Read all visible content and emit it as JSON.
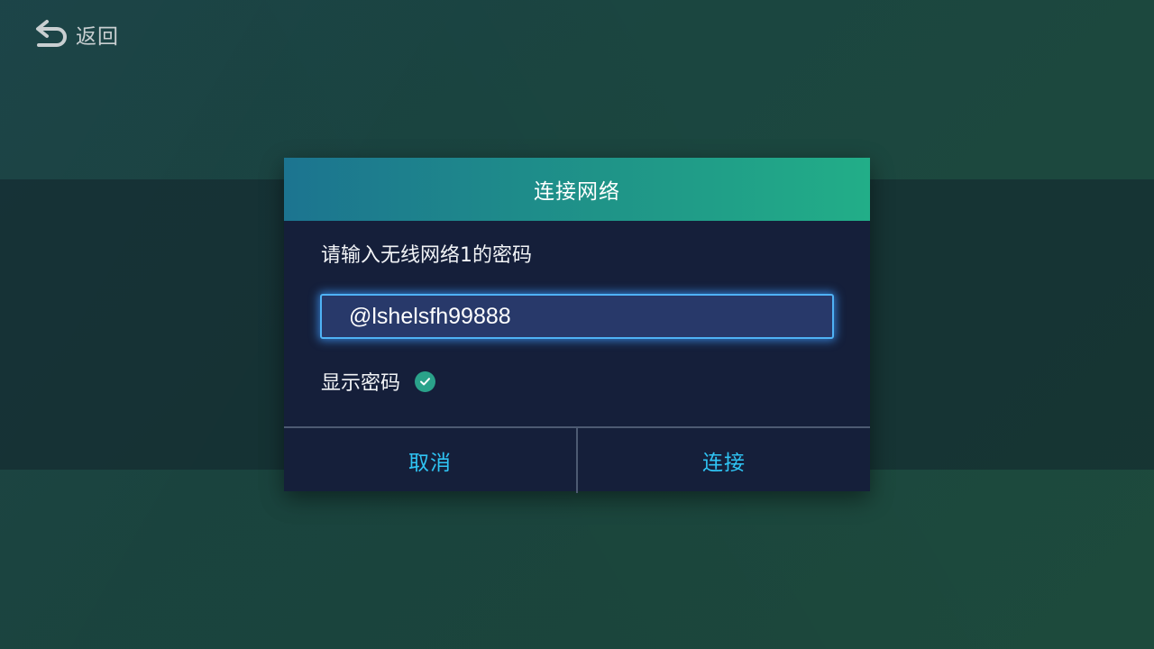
{
  "header": {
    "back_label": "返回"
  },
  "dialog": {
    "title": "连接网络",
    "prompt": "请输入无线网络1的密码",
    "password_value": "@lshelsfh99888",
    "show_password_label": "显示密码",
    "show_password_checked": true,
    "cancel_label": "取消",
    "connect_label": "连接"
  },
  "colors": {
    "accent": "#2fc4f4",
    "header_start": "#1c7490",
    "header_end": "#22ae88",
    "dialog_bg": "#151f3a",
    "check": "#2aa28a"
  },
  "icons": {
    "back": "back-arrow-icon",
    "check": "checkmark-icon"
  }
}
